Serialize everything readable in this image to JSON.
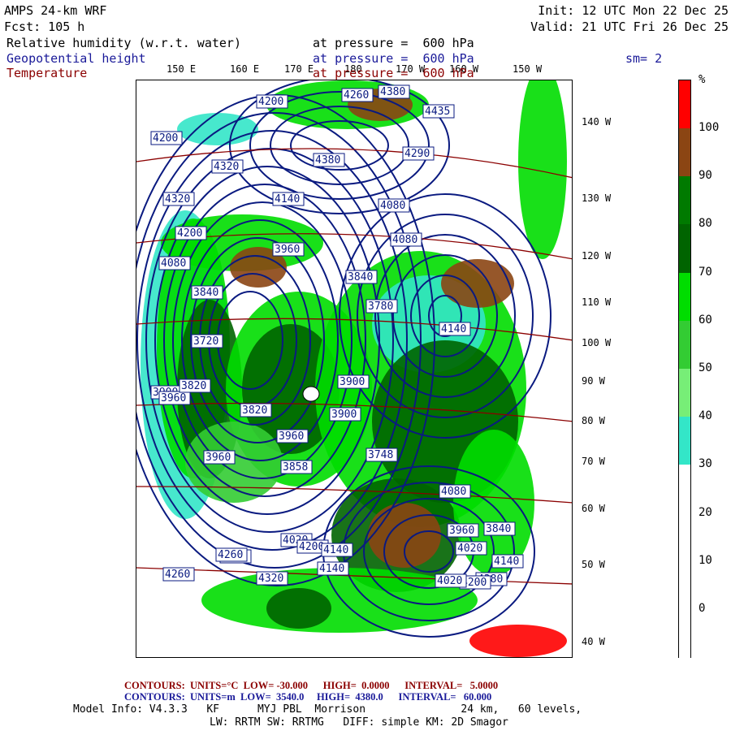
{
  "header": {
    "model": "AMPS 24-km WRF",
    "fcst": "Fcst: 105 h",
    "init": "Init: 12 UTC Mon 22 Dec 25",
    "valid": "Valid: 21 UTC Fri 26 Dec 25",
    "fields": [
      {
        "name": "Relative humidity (w.r.t. water)",
        "level": "at pressure =  600 hPa"
      },
      {
        "name": "Geopotential height",
        "level": "at pressure =  600 hPa"
      },
      {
        "name": "Temperature",
        "level": "at pressure =  600 hPa"
      }
    ],
    "smoothing": "sm= 2"
  },
  "top_lon_labels": [
    "150 E",
    "160 E",
    "170 E",
    "180",
    "170 W",
    "160 W",
    "150 W"
  ],
  "right_lon_labels": [
    "140 W",
    "130 W",
    "120 W",
    "110 W",
    "100 W",
    "90 W",
    "80 W",
    "70 W",
    "60 W",
    "50 W",
    "40 W"
  ],
  "colorbar": {
    "unit": "%",
    "labels": [
      "100",
      "90",
      "80",
      "70",
      "60",
      "50",
      "40",
      "30",
      "20",
      "10",
      "0"
    ],
    "colors": [
      "#ff0000",
      "#8b4513",
      "#007a00",
      "#006400",
      "#00dd00",
      "#33cc33",
      "#77ee77",
      "#33e6c8",
      "#ffffff"
    ]
  },
  "contour_labels": [
    "4200",
    "4260",
    "4380",
    "4435",
    "4200",
    "4320",
    "4380",
    "4290",
    "4320",
    "4140",
    "4080",
    "4200",
    "3960",
    "4080",
    "4080",
    "3840",
    "3840",
    "3780",
    "3720",
    "3900",
    "3820",
    "3960",
    "3820",
    "3900",
    "3960",
    "3900",
    "4140",
    "3748",
    "3858",
    "3960",
    "4080",
    "3960",
    "4020",
    "3840",
    "4140",
    "4020",
    "4200",
    "4200",
    "4260",
    "4260",
    "4320",
    "4140",
    "4380",
    "4200",
    "4140",
    "4020"
  ],
  "footer": {
    "temp_contours": "CONTOURS:  UNITS=°C  LOW= -30.000      HIGH=  0.0000      INTERVAL=   5.0000",
    "height_contours": "CONTOURS:  UNITS=m  LOW=  3540.0     HIGH=  4380.0      INTERVAL=   60.000",
    "model_info": "Model Info: V4.3.3   KF      MYJ PBL  Morrison               24 km,   60 levels,",
    "physics": "LW: RRTM SW: RRTMG   DIFF: simple KM: 2D Smagor"
  }
}
